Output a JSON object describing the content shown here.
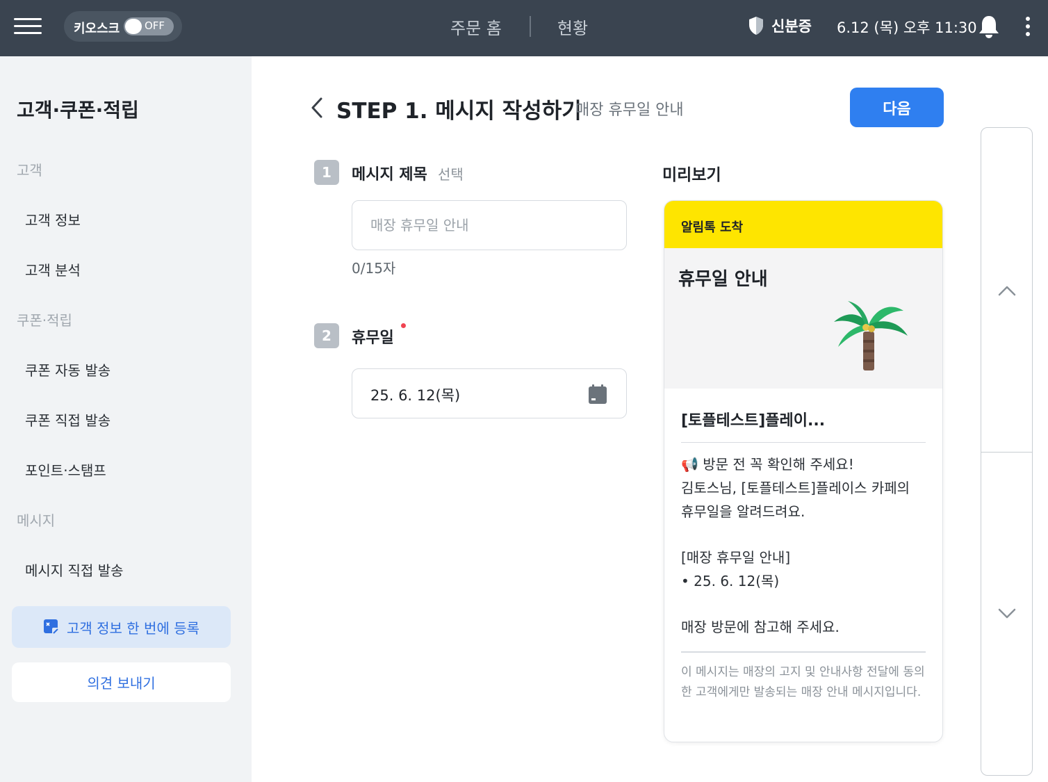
{
  "topbar": {
    "kiosk_label": "키오스크",
    "kiosk_toggle": "OFF",
    "nav_tabs": [
      "주문 홈",
      "현황"
    ],
    "id_card": "신분증",
    "datetime": "6.12 (목) 오후 11:30"
  },
  "sidebar": {
    "title": "고객·쿠폰·적립",
    "sections": [
      {
        "label": "고객",
        "items": [
          "고객 정보",
          "고객 분석"
        ]
      },
      {
        "label": "쿠폰·적립",
        "items": [
          "쿠폰 자동 발송",
          "쿠폰 직접 발송",
          "포인트·스탬프"
        ]
      },
      {
        "label": "메시지",
        "items": [
          "메시지 직접 발송"
        ]
      }
    ],
    "register_button": "고객 정보 한 번에 등록",
    "feedback_button": "의견 보내기"
  },
  "main": {
    "step_title": "STEP 1. 메시지 작성하기",
    "step_subtitle": "매장 휴무일 안내",
    "next_button": "다음",
    "field1": {
      "number": "1",
      "label": "메시지 제목",
      "optional": "선택",
      "placeholder": "매장 휴무일 안내",
      "value": "",
      "char_count": "0/15자"
    },
    "field2": {
      "number": "2",
      "label": "휴무일",
      "value": "25. 6. 12(목)"
    }
  },
  "preview": {
    "label": "미리보기",
    "header": "알림톡 도착",
    "hero_title": "휴무일 안내",
    "store": "[토플테스트]플레이...",
    "body": [
      "📢 방문 전 꼭 확인해 주세요!",
      "김토스님, [토플테스트]플레이스 카페의",
      "휴무일을 알려드려요.",
      "",
      "[매장 휴무일 안내]",
      "• 25. 6. 12(목)",
      "",
      "매장 방문에 참고해 주세요."
    ],
    "footer": "이 메시지는 매장의 고지 및 안내사항 전달에 동의한 고객에게만 발송되는 매장 안내 메시지입니다."
  },
  "colors": {
    "topbar": "#3a4450",
    "accent": "#2f7ff0",
    "kakao_yellow": "#fee500",
    "required": "#f04452"
  },
  "icons": [
    "hamburger-icon",
    "shield-icon",
    "bell-icon",
    "kebab-icon",
    "back-icon",
    "calendar-icon",
    "register-icon",
    "megaphone-icon",
    "palm-tree-icon",
    "chevron-up-icon",
    "chevron-down-icon"
  ]
}
